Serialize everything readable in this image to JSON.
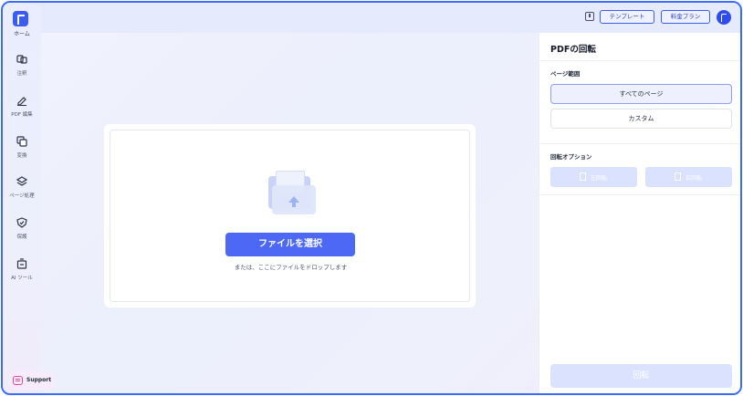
{
  "sidebar": {
    "home_label": "ホーム",
    "items": [
      {
        "label": "注釈",
        "icon": "annotate-icon"
      },
      {
        "label": "PDF 編集",
        "icon": "edit-pen-icon"
      },
      {
        "label": "変換",
        "icon": "convert-icon"
      },
      {
        "label": "ページ処理",
        "icon": "layers-icon"
      },
      {
        "label": "保護",
        "icon": "shield-check-icon"
      },
      {
        "label": "AI ツール",
        "icon": "ai-toolbox-icon"
      }
    ],
    "support_label": "Support"
  },
  "topbar": {
    "template_label": "テンプレート",
    "pricing_label": "料金プラン"
  },
  "main": {
    "select_file_label": "ファイルを選択",
    "drop_hint": "または、ここにファイルをドロップします"
  },
  "panel": {
    "title": "PDFの回転",
    "page_range_label": "ページ範囲",
    "all_pages_label": "すべてのページ",
    "custom_label": "カスタム",
    "rotation_options_label": "回転オプション",
    "rotate_left_label": "左回転",
    "rotate_right_label": "右回転",
    "rotate_button_label": "回転"
  },
  "colors": {
    "accent": "#4e68f6",
    "frame_border": "#3b6cf6",
    "disabled_button": "#dbe2fd"
  }
}
